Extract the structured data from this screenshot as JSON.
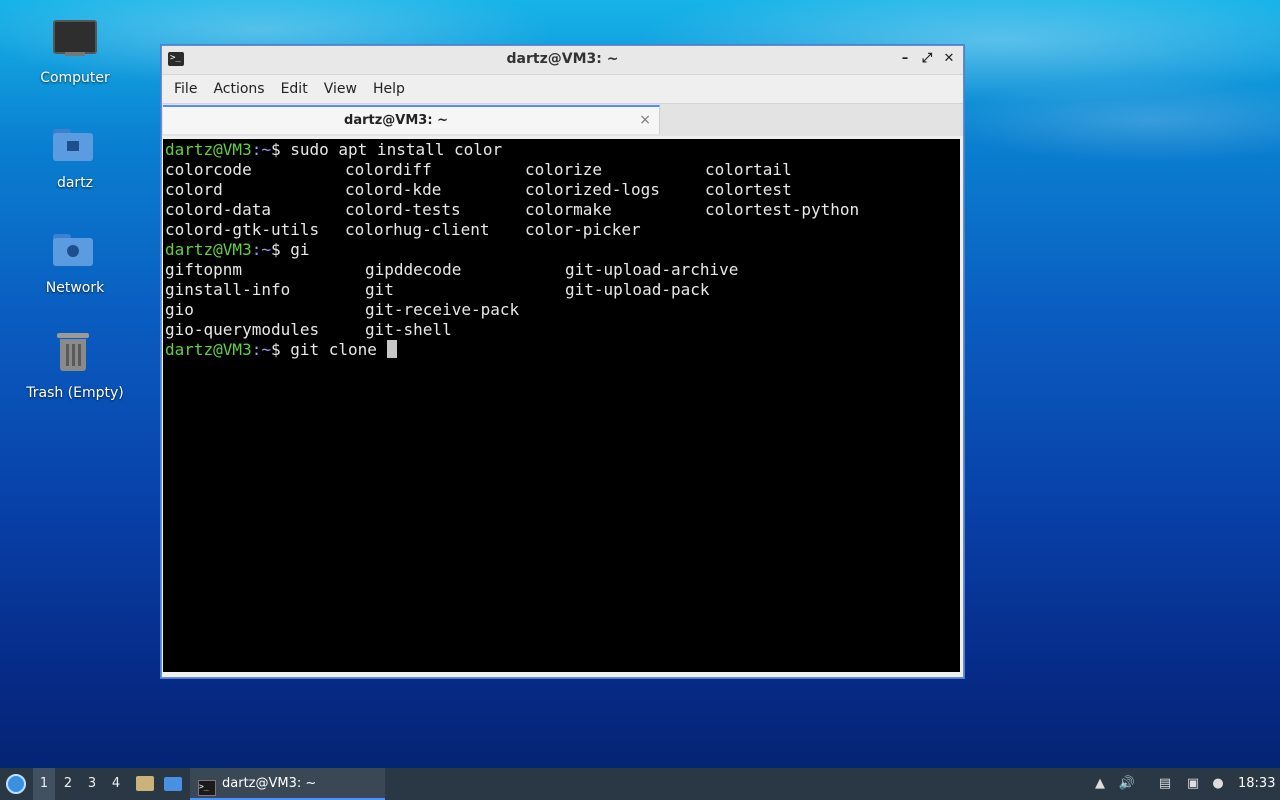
{
  "desktop": {
    "icons": [
      {
        "label": "Computer"
      },
      {
        "label": "dartz"
      },
      {
        "label": "Network"
      },
      {
        "label": "Trash (Empty)"
      }
    ]
  },
  "window": {
    "title": "dartz@VM3: ~",
    "controls": {
      "minimize": "–",
      "maximize": "⤢",
      "close": "✕"
    },
    "menu": [
      "File",
      "Actions",
      "Edit",
      "View",
      "Help"
    ],
    "tab": {
      "label": "dartz@VM3: ~",
      "close": "×"
    }
  },
  "terminal": {
    "prompt_user": "dartz@VM3",
    "prompt_sep": ":~",
    "prompt_dollar": "$ ",
    "cmd1": "sudo apt install color",
    "rows1": [
      [
        "colorcode",
        "colordiff",
        "colorize",
        "colortail"
      ],
      [
        "colord",
        "colord-kde",
        "colorized-logs",
        "colortest"
      ],
      [
        "colord-data",
        "colord-tests",
        "colormake",
        "colortest-python"
      ],
      [
        "colord-gtk-utils",
        "colorhug-client",
        "color-picker",
        ""
      ]
    ],
    "cmd2": "gi",
    "rows2": [
      [
        "giftopnm",
        "gipddecode",
        "git-upload-archive"
      ],
      [
        "ginstall-info",
        "git",
        "git-upload-pack"
      ],
      [
        "gio",
        "git-receive-pack",
        ""
      ],
      [
        "gio-querymodules",
        "git-shell",
        ""
      ]
    ],
    "cmd3": "git clone "
  },
  "taskbar": {
    "workspaces": [
      "1",
      "2",
      "3",
      "4"
    ],
    "active_workspace": "1",
    "task_label": "dartz@VM3: ~",
    "clock": "18:33"
  }
}
